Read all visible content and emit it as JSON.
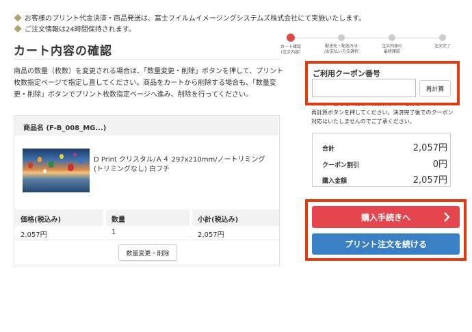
{
  "notices": [
    "お客様のプリント代金決済・商品発送は、富士フイルムイメージングシステムズ株式会社にて実施いたします。",
    "ご注文情報は24時間保持されます。"
  ],
  "page_title": "カート内容の確認",
  "steps": [
    {
      "label": "カート確認\n(注文内容)",
      "active": true
    },
    {
      "label": "配送先・配送方法\n/お支払い方法選択",
      "active": false
    },
    {
      "label": "注文内容の\n最終確認",
      "active": false
    },
    {
      "label": "注文完了",
      "active": false
    }
  ],
  "description": "商品の数量（枚数）を変更される場合は、「数量変更・削除」ボタンを押して、プリント枚数指定ページで指定し直してください。商品をカートから削除する場合も、「数量変更・削除」ボタンでプリント枚数指定ページへ進み、削除を行ってください。",
  "cart": {
    "product_header": "商品名 (F-B_008_MG...)",
    "product_name": "D Print クリスタル/Ａ４ 297x210mm/ノートリミング(トリミングなし) 白フチ",
    "columns": [
      "価格(税込み)",
      "数量",
      "小計(税込み)"
    ],
    "values": [
      "2,057円",
      "1",
      "2,057円"
    ],
    "qty_button": "数量変更・削除"
  },
  "coupon": {
    "label": "ご利用クーポン番号",
    "value": "",
    "placeholder": "",
    "recalc_button": "再計算",
    "note_line1": "クーポン番号を入力し、再計算ボタンを押し",
    "note_line2": "再計算ボタンを押してください。決済完了後でのクーポン対応はいたしませんのでご了承ください。"
  },
  "summary": {
    "rows": [
      {
        "key": "合計",
        "value": "2,057円"
      },
      {
        "key": "クーポン割引",
        "value": "0円"
      },
      {
        "key": "購入金額",
        "value": "2,057円"
      }
    ]
  },
  "buttons": {
    "purchase": "購入手続きへ",
    "continue": "プリント注文を続ける"
  },
  "colors": {
    "highlight": "#e03a10",
    "purchase": "#e5464d",
    "continue": "#3a7fc4",
    "step_active": "#e04a4a",
    "notice_diamond": "#b5a07a"
  },
  "icons": [
    "diamond-bullet-icon",
    "chevron-right-icon"
  ]
}
